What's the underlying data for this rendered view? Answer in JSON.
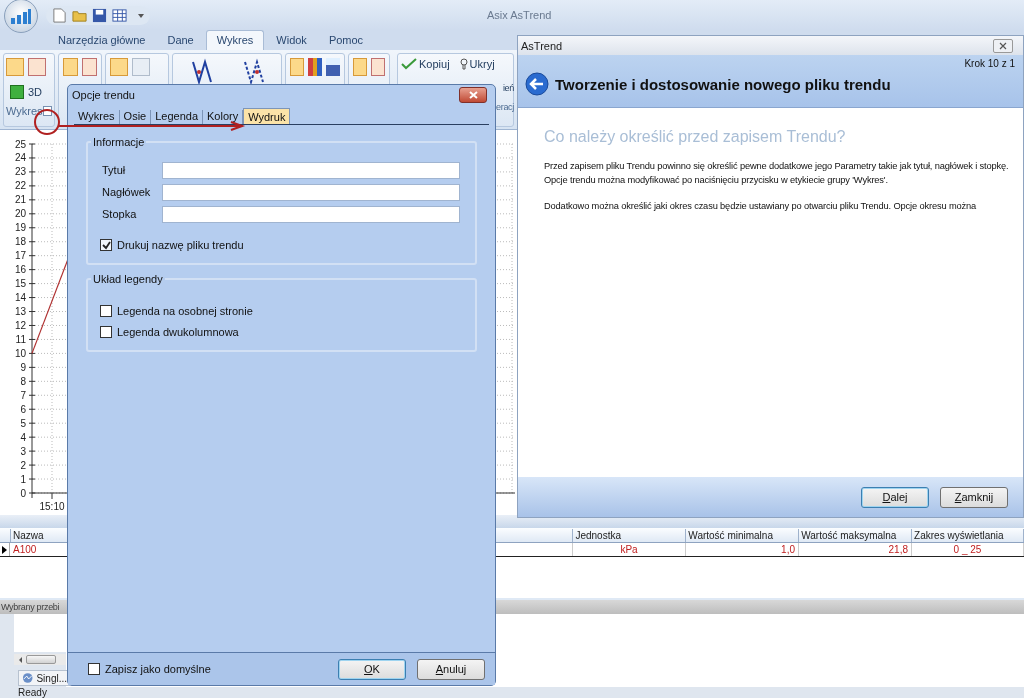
{
  "app": {
    "title": "Asix AsTrend"
  },
  "ribbon_tabs": [
    {
      "label": "Narzędzia główne",
      "selected": false
    },
    {
      "label": "Dane",
      "selected": false
    },
    {
      "label": "Wykres",
      "selected": true
    },
    {
      "label": "Widok",
      "selected": false
    },
    {
      "label": "Pomoc",
      "selected": false
    }
  ],
  "ribbon": {
    "button_3d": "3D",
    "copy_button": "Kopiuj",
    "hide_button": "Ukryj",
    "group_label": "Wykres",
    "cut_button": "ień",
    "cut_group_label": "eracj"
  },
  "chart": {
    "y_axis_labels": [
      "25",
      "24",
      "23",
      "22",
      "21",
      "20",
      "19",
      "18",
      "17",
      "16",
      "15",
      "14",
      "13",
      "12",
      "11",
      "10",
      "9",
      "8",
      "7",
      "6",
      "5",
      "4",
      "3",
      "2",
      "1",
      "0"
    ],
    "x_axis_labels": [
      "15:10"
    ]
  },
  "table": {
    "columns": [
      "Nazwa",
      "Jednostka",
      "Wartość minimalna",
      "Wartość maksymalna",
      "Zakres wyświetlania"
    ],
    "rows": [
      {
        "selected": true,
        "cells": [
          "A100",
          "kPa",
          "1,0",
          "21,8",
          "0 _ 25"
        ]
      }
    ]
  },
  "bottom_panel": {
    "title": "Wybrany przebi",
    "button": "Singl..."
  },
  "status_bar": "Ready",
  "options_dialog": {
    "title": "Opcje trendu",
    "tabs": [
      {
        "label": "Wykres",
        "selected": false
      },
      {
        "label": "Osie",
        "selected": false
      },
      {
        "label": "Legenda",
        "selected": false
      },
      {
        "label": "Kolory",
        "selected": false
      },
      {
        "label": "Wydruk",
        "selected": true
      }
    ],
    "groups": [
      {
        "title": "Informacje",
        "fields": [
          {
            "label": "Tytuł"
          },
          {
            "label": "Nagłówek"
          },
          {
            "label": "Stopka"
          }
        ],
        "checkboxes": [
          {
            "label": "Drukuj nazwę pliku trendu",
            "checked": true
          }
        ]
      },
      {
        "title": "Układ legendy",
        "checkboxes": [
          {
            "label": "Legenda na osobnej stronie",
            "checked": false
          },
          {
            "label": "Legenda dwukolumnowa",
            "checked": false
          }
        ]
      }
    ],
    "footer_checkbox": {
      "label": "Zapisz jako domyślne",
      "checked": false
    },
    "buttons": [
      {
        "label": "OK",
        "focused": true
      },
      {
        "label": "Anuluj",
        "focused": false
      }
    ]
  },
  "wizard": {
    "title": "AsTrend",
    "step": "Krok 10 z 1",
    "header": "Tworzenie i dostosowanie nowego pliku trendu",
    "heading": "Co należy określić przed zapisem Trendu?",
    "paragraphs": [
      "Przed zapisem pliku Trendu powinno się określić pewne dodatkowe jego Parametry takie jak tytuł, nagłówek i stopkę. Opcje trendu można modyfikować po naciśnięciu przycisku w etykiecie grupy 'Wykres'.",
      "Dodatkowo można określić jaki okres czasu będzie ustawiany po otwarciu pliku Trendu. Opcje okresu można"
    ],
    "buttons": [
      {
        "label": "Dalej",
        "focused": true
      },
      {
        "label": "Zamknij",
        "focused": false
      }
    ]
  }
}
